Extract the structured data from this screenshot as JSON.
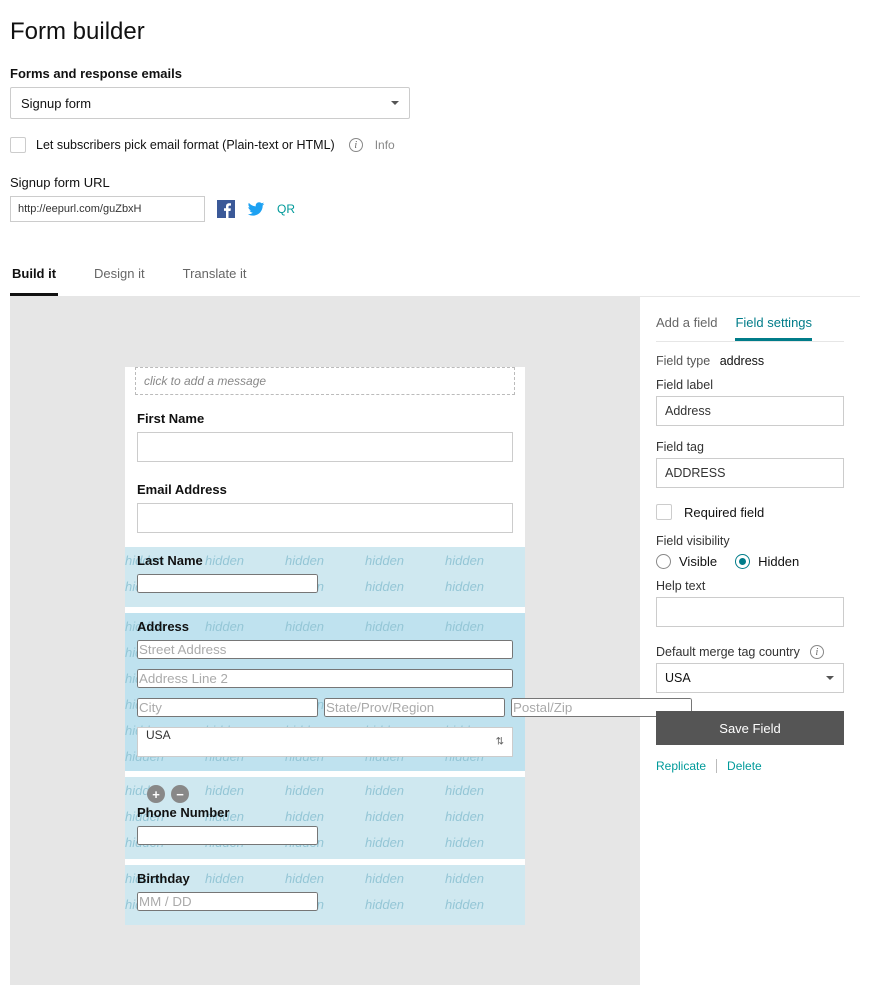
{
  "page": {
    "title": "Form builder"
  },
  "forms_selector": {
    "label": "Forms and response emails",
    "value": "Signup form"
  },
  "format_checkbox": {
    "label": "Let subscribers pick email format (Plain-text or HTML)",
    "info_label": "Info"
  },
  "signup_url": {
    "label": "Signup form URL",
    "value": "http://eepurl.com/guZbxH",
    "qr_label": "QR"
  },
  "tabs": {
    "build": "Build it",
    "design": "Design it",
    "translate": "Translate it"
  },
  "form_card": {
    "message_placeholder": "click to add a message",
    "fields": {
      "first_name": {
        "label": "First Name"
      },
      "email": {
        "label": "Email Address"
      },
      "last_name": {
        "label": "Last Name"
      },
      "address": {
        "label": "Address",
        "street_placeholder": "Street Address",
        "line2_placeholder": "Address Line 2",
        "city_placeholder": "City",
        "state_placeholder": "State/Prov/Region",
        "postal_placeholder": "Postal/Zip",
        "country_value": "USA"
      },
      "phone": {
        "label": "Phone Number"
      },
      "birthday": {
        "label": "Birthday",
        "placeholder": "MM / DD"
      }
    }
  },
  "sidebar": {
    "tabs": {
      "add": "Add a field",
      "settings": "Field settings"
    },
    "field_type": {
      "label": "Field type",
      "value": "address"
    },
    "field_label": {
      "label": "Field label",
      "value": "Address"
    },
    "field_tag": {
      "label": "Field tag",
      "value": "ADDRESS"
    },
    "required": {
      "label": "Required field"
    },
    "visibility": {
      "label": "Field visibility",
      "visible": "Visible",
      "hidden": "Hidden"
    },
    "help_text": {
      "label": "Help text",
      "value": ""
    },
    "default_country": {
      "label": "Default merge tag country",
      "value": "USA"
    },
    "save": "Save Field",
    "replicate": "Replicate",
    "delete": "Delete"
  }
}
